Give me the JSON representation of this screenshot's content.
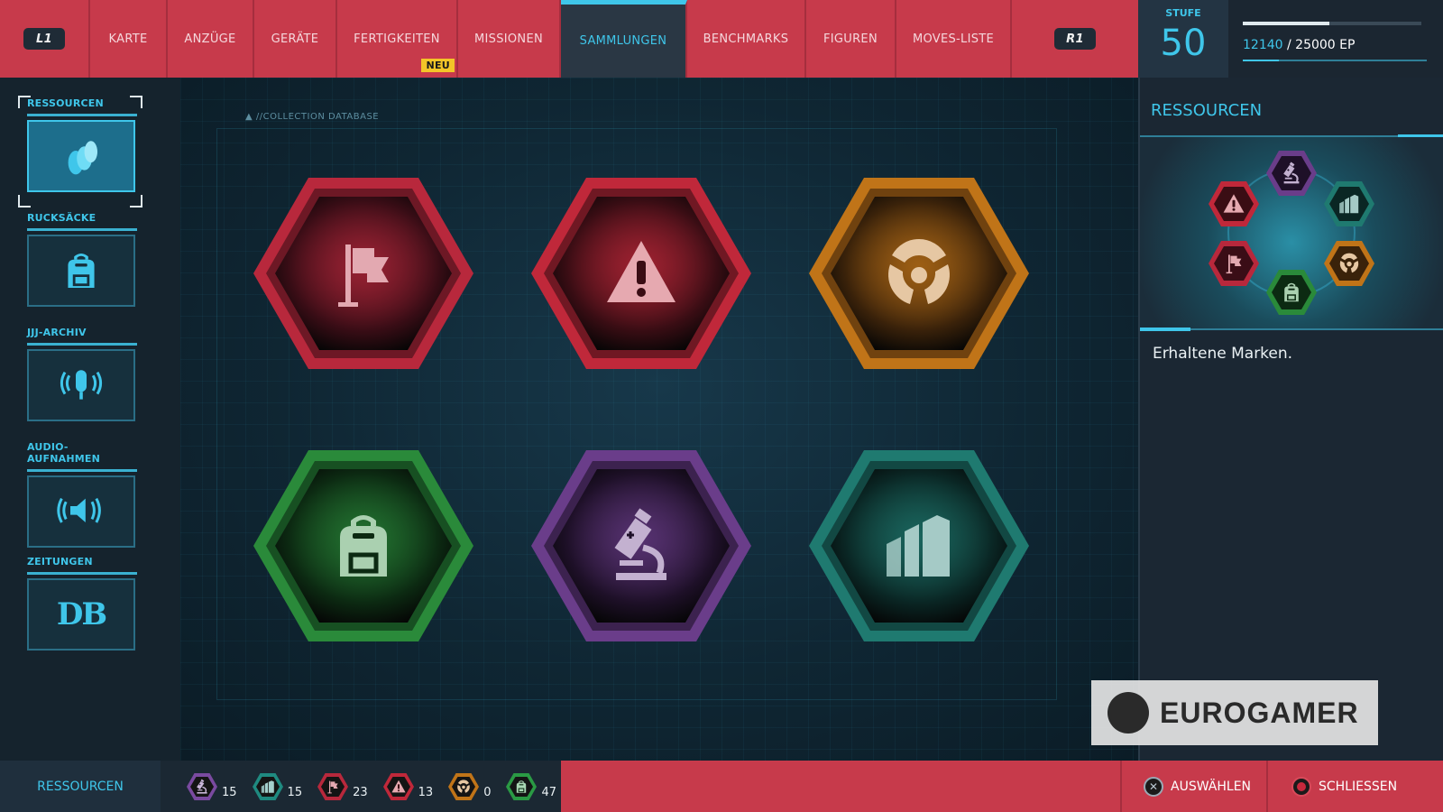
{
  "nav": {
    "left_bumper": "L1",
    "right_bumper": "R1",
    "tabs": [
      {
        "label": "KARTE",
        "width": 86
      },
      {
        "label": "ANZÜGE",
        "width": 96
      },
      {
        "label": "GERÄTE",
        "width": 92
      },
      {
        "label": "FERTIGKEITEN",
        "width": 134,
        "badge": "NEU"
      },
      {
        "label": "MISSIONEN",
        "width": 114
      },
      {
        "label": "SAMMLUNGEN",
        "width": 140,
        "active": true
      },
      {
        "label": "BENCHMARKS",
        "width": 132
      },
      {
        "label": "FIGUREN",
        "width": 100
      },
      {
        "label": "MOVES-LISTE",
        "width": 128
      }
    ]
  },
  "level": {
    "label": "STUFE",
    "value": "50"
  },
  "xp": {
    "current": "12140",
    "total": "/ 25000 EP",
    "progress": 0.4856
  },
  "categories": [
    {
      "label": "RESSOURCEN",
      "icon": "coins-icon",
      "active": true
    },
    {
      "label": "RUCKSÄCKE",
      "icon": "backpack-icon"
    },
    {
      "label": "JJJ-ARCHIV",
      "icon": "microphone-icon"
    },
    {
      "label": "AUDIO-AUFNAHMEN",
      "icon": "speaker-icon"
    },
    {
      "label": "ZEITUNGEN",
      "icon": "daily-bugle-icon",
      "icon_text": "DB"
    }
  ],
  "main": {
    "db_title": "//COLLECTION DATABASE",
    "tokens": [
      {
        "name": "landmark-token",
        "icon": "flag-icon",
        "color": "#b8283c",
        "dark": "#3a0d16"
      },
      {
        "name": "crime-token",
        "icon": "warning-icon",
        "color": "#c0283a",
        "dark": "#3a0d14"
      },
      {
        "name": "base-token",
        "icon": "fisk-hideout-icon",
        "color": "#c07418",
        "dark": "#3a220a"
      },
      {
        "name": "backpack-token",
        "icon": "backpack-icon",
        "color": "#2a8a3a",
        "dark": "#0c2a12"
      },
      {
        "name": "research-token",
        "icon": "microscope-icon",
        "color": "#6a3d8a",
        "dark": "#1e1028"
      },
      {
        "name": "challenge-token",
        "icon": "buildings-icon",
        "color": "#1f7a70",
        "dark": "#0a2624"
      }
    ]
  },
  "panel": {
    "title": "RESSOURCEN",
    "description": "Erhaltene Marken."
  },
  "watermark": {
    "brand": "EUROGAMER"
  },
  "bottom": {
    "label": "RESSOURCEN",
    "counts": [
      {
        "icon": "microscope-icon",
        "color": "#7a4aa0",
        "value": "15"
      },
      {
        "icon": "buildings-icon",
        "color": "#1f8a80",
        "value": "15"
      },
      {
        "icon": "flag-icon",
        "color": "#b8283c",
        "value": "23"
      },
      {
        "icon": "warning-icon",
        "color": "#c0283a",
        "value": "13"
      },
      {
        "icon": "fisk-hideout-icon",
        "color": "#c07418",
        "value": "0"
      },
      {
        "icon": "backpack-icon",
        "color": "#2a9a44",
        "value": "47"
      }
    ],
    "select_label": "AUSWÄHLEN",
    "close_label": "SCHLIESSEN"
  }
}
